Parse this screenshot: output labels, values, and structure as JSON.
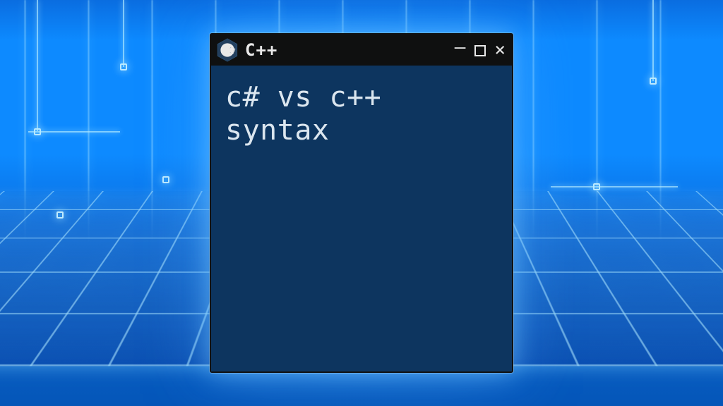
{
  "window": {
    "title": "C++",
    "icon": "cpp-hexagon-icon",
    "controls": {
      "minimize_glyph": "—",
      "close_glyph": "×"
    }
  },
  "content": {
    "text": "c# vs c++\nsyntax"
  }
}
